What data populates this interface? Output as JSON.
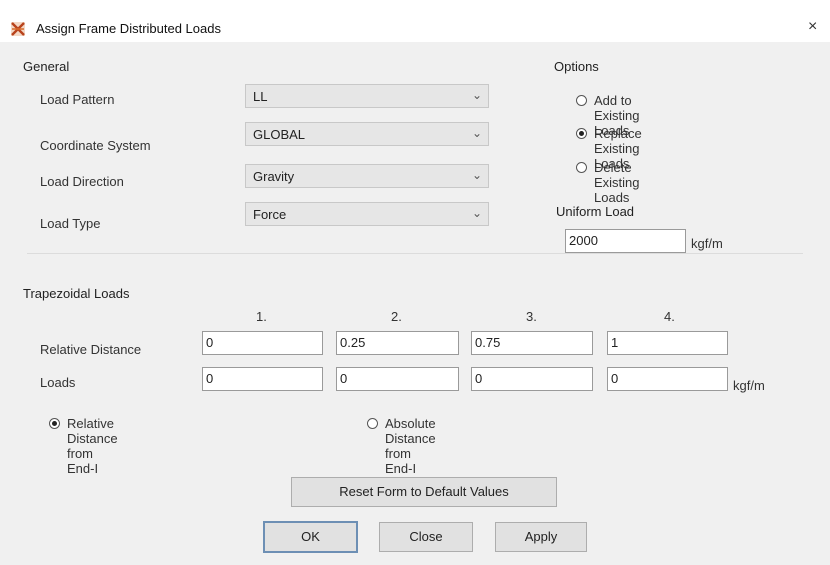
{
  "window": {
    "title": "Assign Frame Distributed Loads",
    "close_glyph": "×"
  },
  "general": {
    "title": "General",
    "load_pattern": {
      "label": "Load Pattern",
      "value": "LL"
    },
    "coordinate_system": {
      "label": "Coordinate System",
      "value": "GLOBAL"
    },
    "load_direction": {
      "label": "Load Direction",
      "value": "Gravity"
    },
    "load_type": {
      "label": "Load Type",
      "value": "Force"
    }
  },
  "options": {
    "title": "Options",
    "items": [
      {
        "label": "Add to Existing Loads",
        "selected": false
      },
      {
        "label": "Replace Existing Loads",
        "selected": true
      },
      {
        "label": "Delete Existing Loads",
        "selected": false
      }
    ]
  },
  "uniform_load": {
    "title": "Uniform Load",
    "value": "2000",
    "unit": "kgf/m"
  },
  "trapezoidal": {
    "title": "Trapezoidal Loads",
    "columns": [
      "1.",
      "2.",
      "3.",
      "4."
    ],
    "relative_distance": {
      "label": "Relative Distance",
      "values": [
        "0",
        "0.25",
        "0.75",
        "1"
      ]
    },
    "loads": {
      "label": "Loads",
      "values": [
        "0",
        "0",
        "0",
        "0"
      ],
      "unit": "kgf/m"
    },
    "distance_mode": [
      {
        "label": "Relative Distance from End-I",
        "selected": true
      },
      {
        "label": "Absolute Distance from End-I",
        "selected": false
      }
    ]
  },
  "buttons": {
    "reset": "Reset Form to Default Values",
    "ok": "OK",
    "close": "Close",
    "apply": "Apply"
  },
  "icons": {
    "app": "frame-load-app-icon",
    "dropdown": "chevron-down-icon"
  },
  "colors": {
    "dialog_bg": "#f0f0f0",
    "titlebar_bg": "#ffffff",
    "default_button_border": "#6d8fb4"
  }
}
